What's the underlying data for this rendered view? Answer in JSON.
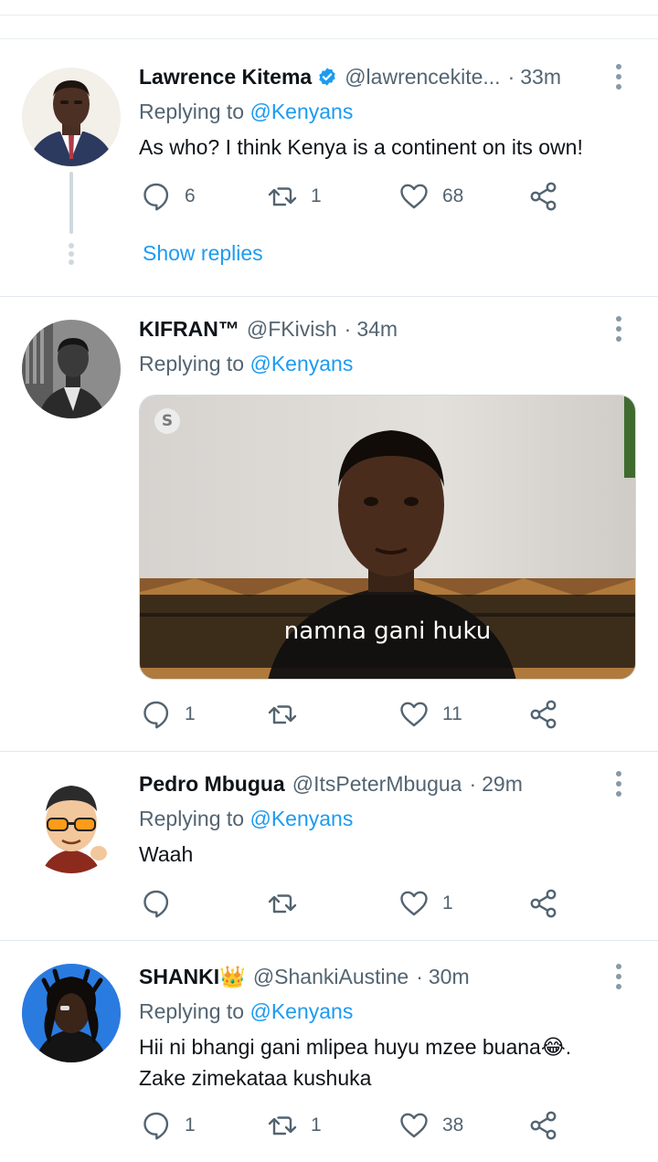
{
  "tweets": [
    {
      "name": "Lawrence Kitema",
      "verified": true,
      "handle": "@lawrencekite...",
      "time": "33m",
      "replying_prefix": "Replying to ",
      "replying_to": "@Kenyans",
      "text": "As who? I think Kenya is a continent on its own!",
      "replies": "6",
      "retweets": "1",
      "likes": "68",
      "show_replies": "Show replies"
    },
    {
      "name": "KIFRAN™",
      "handle": "@FKivish",
      "time": "34m",
      "replying_prefix": "Replying to ",
      "replying_to": "@Kenyans",
      "media_caption": "namna gani huku",
      "media_logo": "S",
      "replies": "1",
      "retweets": "",
      "likes": "11"
    },
    {
      "name": "Pedro Mbugua",
      "handle": "@ItsPeterMbugua",
      "time": "29m",
      "replying_prefix": "Replying to ",
      "replying_to": "@Kenyans",
      "text": "Waah",
      "replies": "",
      "retweets": "",
      "likes": "1"
    },
    {
      "name": "SHANKI👑",
      "handle": "@ShankiAustine",
      "time": "30m",
      "replying_prefix": "Replying to ",
      "replying_to": "@Kenyans",
      "text_line1": "Hii ni bhangi gani mlipea huyu mzee buana😂.",
      "text_line2": "Zake zimekataa kushuka",
      "replies": "1",
      "retweets": "1",
      "likes": "38"
    }
  ],
  "colors": {
    "accent": "#1d9bf0",
    "secondary_text": "#536471",
    "divider": "#e1e8ed"
  },
  "icons": {
    "reply": "speech-bubble",
    "retweet": "two-arrows-loop",
    "like": "heart",
    "share": "share-nodes",
    "more": "vertical-ellipsis",
    "verified": "blue-check-badge"
  }
}
